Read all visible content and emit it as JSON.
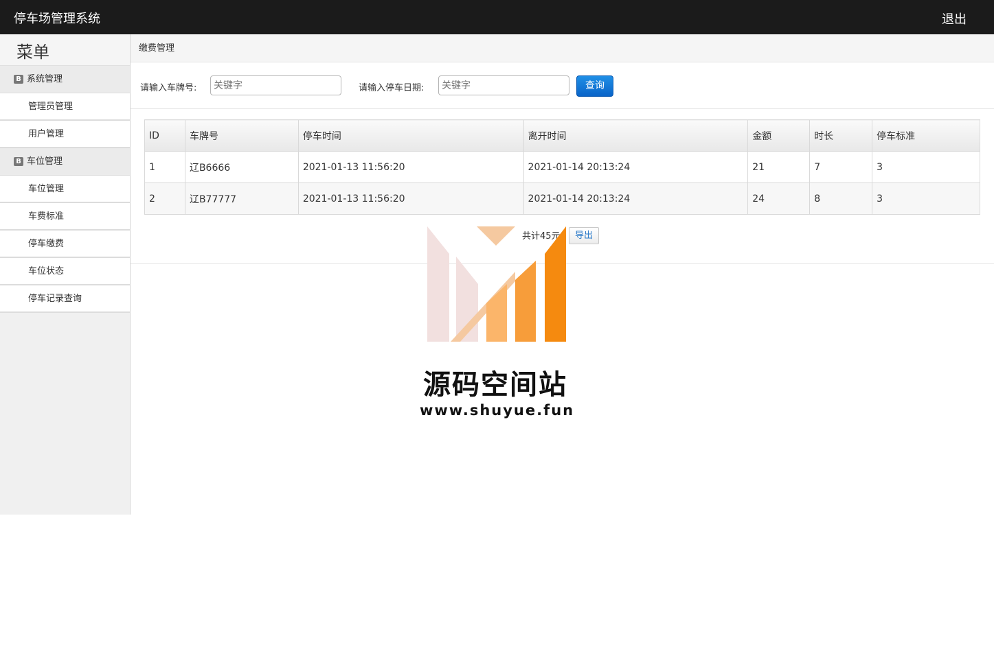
{
  "header": {
    "app_title": "停车场管理系统",
    "logout_label": "退出"
  },
  "sidebar": {
    "menu_title": "菜单",
    "groups": [
      {
        "label": "系统管理",
        "items": [
          {
            "label": "管理员管理"
          },
          {
            "label": "用户管理"
          }
        ]
      },
      {
        "label": "车位管理",
        "items": [
          {
            "label": "车位管理"
          },
          {
            "label": "车费标准"
          },
          {
            "label": "停车缴费"
          },
          {
            "label": "车位状态"
          },
          {
            "label": "停车记录查询"
          }
        ]
      }
    ]
  },
  "main": {
    "breadcrumb": "缴费管理",
    "search": {
      "plate_label": "请输入车牌号:",
      "plate_placeholder": "关键字",
      "plate_value": "",
      "date_label": "请输入停车日期:",
      "date_placeholder": "关键字",
      "date_value": "",
      "query_label": "查询"
    },
    "table": {
      "headers": [
        "ID",
        "车牌号",
        "停车时间",
        "离开时间",
        "金额",
        "时长",
        "停车标准"
      ],
      "rows": [
        [
          "1",
          "辽B6666",
          "2021-01-13 11:56:20",
          "2021-01-14 20:13:24",
          "21",
          "7",
          "3"
        ],
        [
          "2",
          "辽B77777",
          "2021-01-13 11:56:20",
          "2021-01-14 20:13:24",
          "24",
          "8",
          "3"
        ]
      ]
    },
    "pager": {
      "total_text": "共计45元",
      "export_label": "导出"
    }
  },
  "watermark": {
    "name": "源码空间站",
    "url": "www.shuyue.fun",
    "colors": [
      "#f2e0df",
      "#f5c9a0",
      "#fbb56a",
      "#f79d3a",
      "#f58a0f"
    ]
  }
}
